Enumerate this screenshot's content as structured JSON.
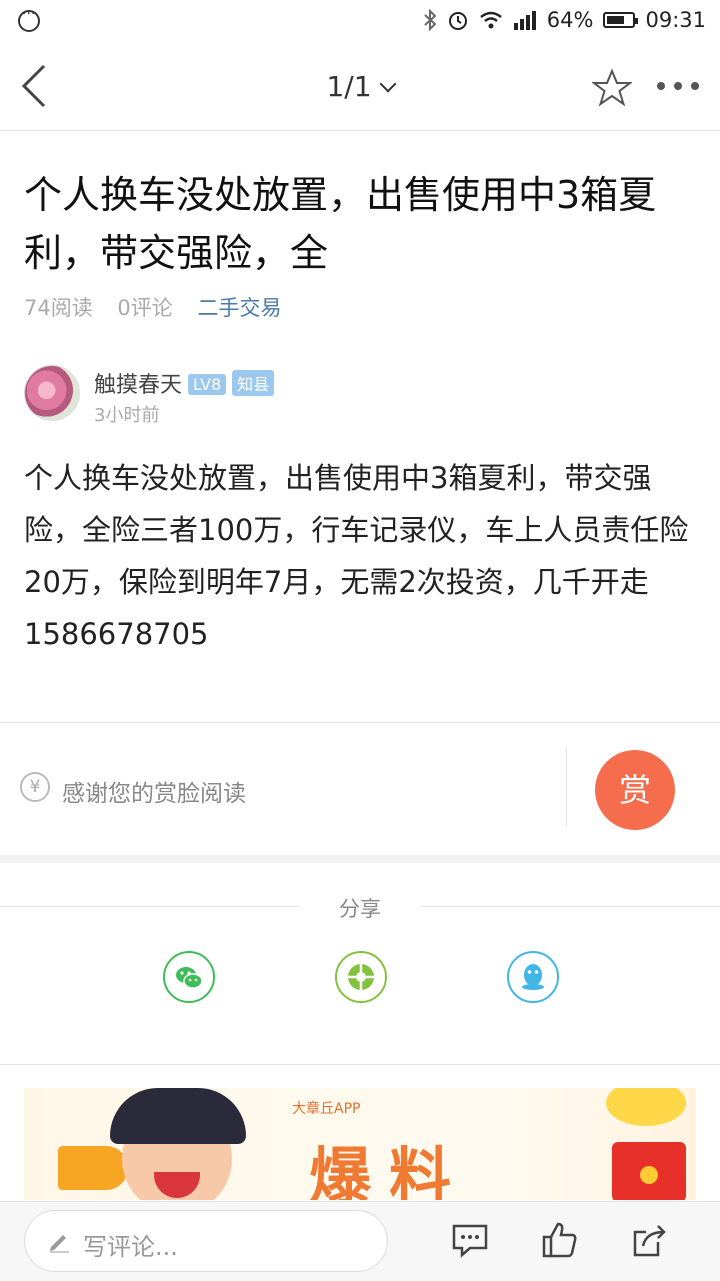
{
  "status_bar": {
    "battery": "64%",
    "time": "09:31"
  },
  "nav": {
    "page_indicator": "1/1"
  },
  "article": {
    "title": "个人换车没处放置，出售使用中3箱夏利，带交强险，全",
    "reads": "74阅读",
    "comments": "0评论",
    "category": "二手交易",
    "author": {
      "name": "触摸春天",
      "level": "LV8",
      "rank": "知县",
      "time": "3小时前"
    },
    "body": "个人换车没处放置，出售使用中3箱夏利，带交强险，全险三者100万，行车记录仪，车上人员责任险20万，保险到明年7月，无需2次投资，几千开走1586678705"
  },
  "reward": {
    "text": "感谢您的赏脸阅读",
    "button": "赏"
  },
  "share": {
    "label": "分享",
    "targets": [
      "wechat-icon",
      "moments-icon",
      "qq-icon"
    ]
  },
  "banner": {
    "app": "大章丘APP",
    "headline": "爆料"
  },
  "bottom_bar": {
    "comment_placeholder": "写评论..."
  },
  "colors": {
    "accent": "#f56d4c",
    "category": "#4a7aa8",
    "wechat": "#3dbd57",
    "moments": "#83c23e",
    "qq": "#3fb6e6"
  }
}
